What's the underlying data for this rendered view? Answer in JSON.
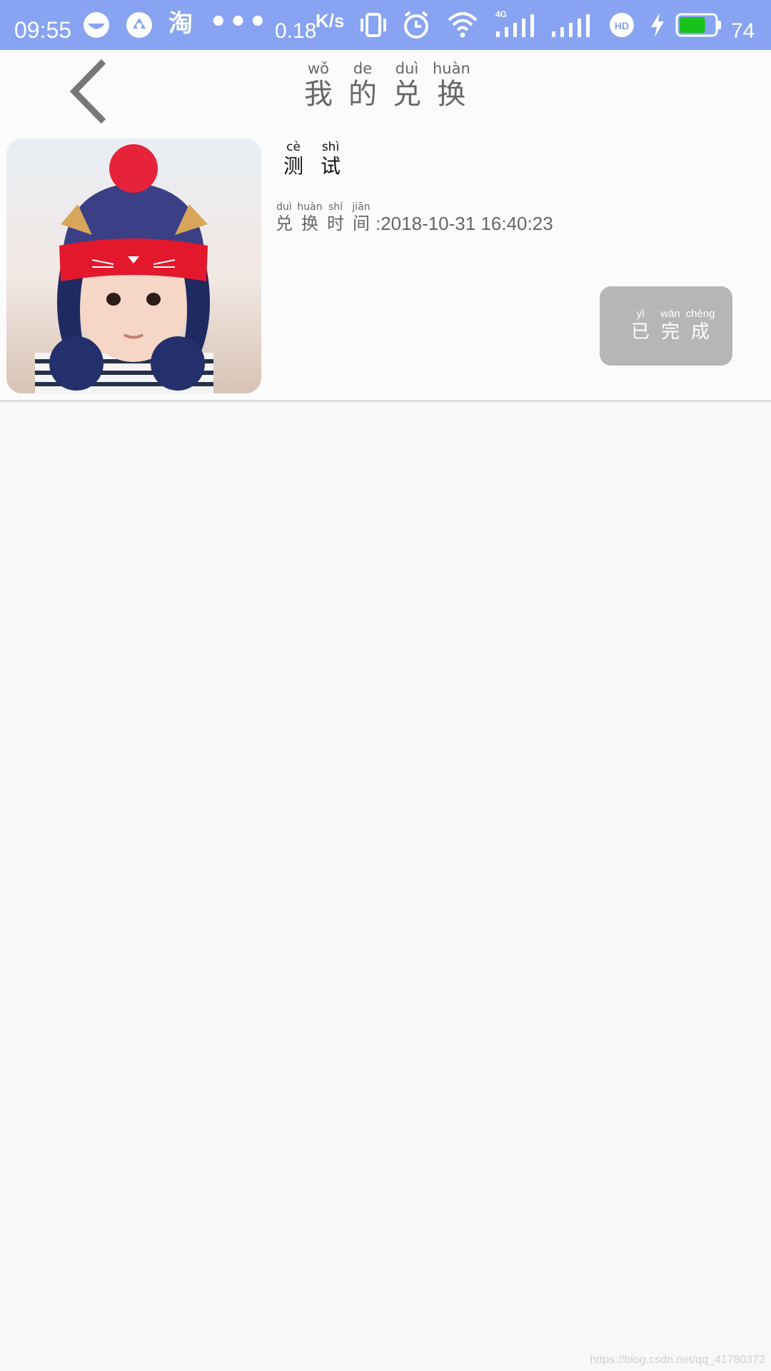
{
  "status_bar": {
    "time": "09:55",
    "taobao_char": "淘",
    "more": "•••",
    "net_speed": "0.18",
    "speed_unit": "K/s",
    "network_type": "4G",
    "hd_label": "HD",
    "battery_level": "74",
    "battery_fill_fraction": 0.74,
    "color_bar": "#87a3f2",
    "color_battery": "#19c21b"
  },
  "header": {
    "back_icon": "chevron-left-icon",
    "title_chars": [
      {
        "hz": "我",
        "py": "wǒ"
      },
      {
        "hz": "的",
        "py": "de"
      },
      {
        "hz": "兑",
        "py": "duì"
      },
      {
        "hz": "换",
        "py": "huàn"
      }
    ]
  },
  "item": {
    "image_desc": "baby-in-knit-hat",
    "name_chars": [
      {
        "hz": "测",
        "py": "cè"
      },
      {
        "hz": "试",
        "py": "shì"
      }
    ],
    "time_label_chars": [
      {
        "hz": "兑",
        "py": "duì"
      },
      {
        "hz": "换",
        "py": "huàn"
      },
      {
        "hz": "时",
        "py": "shí"
      },
      {
        "hz": "间",
        "py": "jiān"
      }
    ],
    "time_value": ":2018-10-31 16:40:23",
    "status_chars": [
      {
        "hz": "已",
        "py": "yǐ"
      },
      {
        "hz": "完",
        "py": "wán"
      },
      {
        "hz": "成",
        "py": "chéng"
      }
    ],
    "status_color": "#b6b6b6"
  },
  "watermark": "https://blog.csdn.net/qq_41780372"
}
